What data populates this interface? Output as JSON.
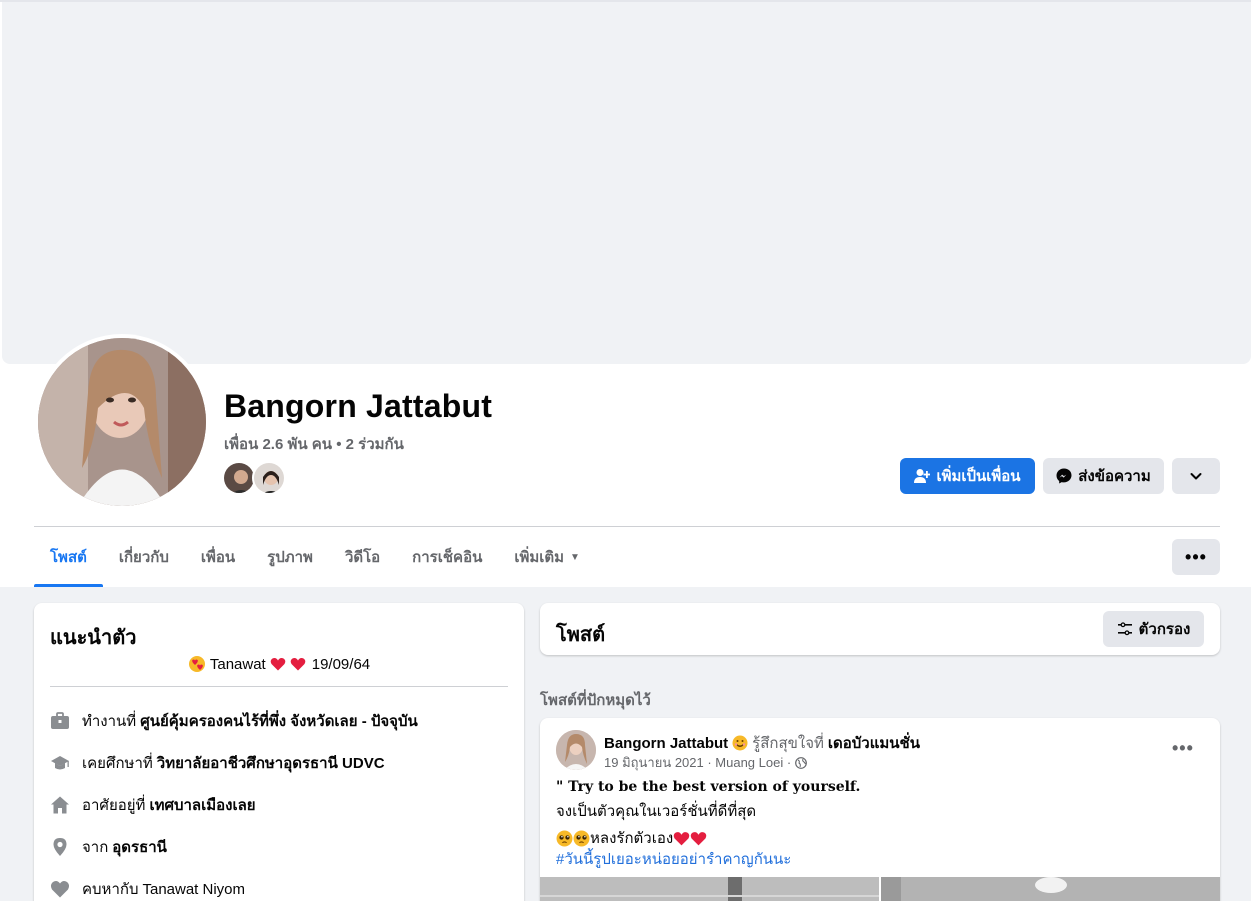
{
  "profile": {
    "name": "Bangorn Jattabut",
    "friends_text": "เพื่อน 2.6 พัน คน • 2 ร่วมกัน"
  },
  "actions": {
    "add_friend": "เพิ่มเป็นเพื่อน",
    "message": "ส่งข้อความ"
  },
  "tabs": [
    {
      "label": "โพสต์",
      "active": true
    },
    {
      "label": "เกี่ยวกับ"
    },
    {
      "label": "เพื่อน"
    },
    {
      "label": "รูปภาพ"
    },
    {
      "label": "วิดีโอ"
    },
    {
      "label": "การเช็คอิน"
    },
    {
      "label": "เพิ่มเติม"
    }
  ],
  "intro": {
    "title": "แนะนำตัว",
    "bio_name": "Tanawat",
    "bio_date": "19/09/64",
    "rows": [
      {
        "icon": "briefcase-icon",
        "prefix": "ทำงานที่",
        "value": "ศูนย์คุ้มครองคนไร้ที่พึ่ง จังหวัดเลย - ปัจจุบัน"
      },
      {
        "icon": "graduation-cap-icon",
        "prefix": "เคยศึกษาที่",
        "value": "วิทยาลัยอาชีวศึกษาอุดรธานี UDVC"
      },
      {
        "icon": "home-icon",
        "prefix": "อาศัยอยู่ที่",
        "value": "เทศบาลเมืองเลย"
      },
      {
        "icon": "location-pin-icon",
        "prefix": "จาก",
        "value": "อุดรธานี"
      },
      {
        "icon": "heart-icon",
        "prefix": "คบหากับ",
        "value": "Tanawat Niyom"
      }
    ]
  },
  "posts": {
    "title": "โพสต์",
    "filter_label": "ตัวกรอง",
    "pinned_label": "โพสต์ที่ปักหมุดไว้"
  },
  "post": {
    "author": "Bangorn Jattabut",
    "feeling": "รู้สึกสุขใจที่",
    "place": "เดอบัวแมนชั่น",
    "meta": "19 มิถุนายน 2021 · Muang Loei ·",
    "quote": "\" Try to be the best version of yourself.",
    "line2": "จงเป็นตัวคุณในเวอร์ชั่นที่ดีที่สุด",
    "line3": "หลงรักตัวเอง",
    "hashtag": "#วันนี้รูปเยอะหน่อยอย่ารำคาญกันนะ"
  },
  "colors": {
    "primary": "#1b74e4",
    "link": "#216fdb",
    "heart": "#e41e3f",
    "page_bg": "#f0f2f5"
  }
}
